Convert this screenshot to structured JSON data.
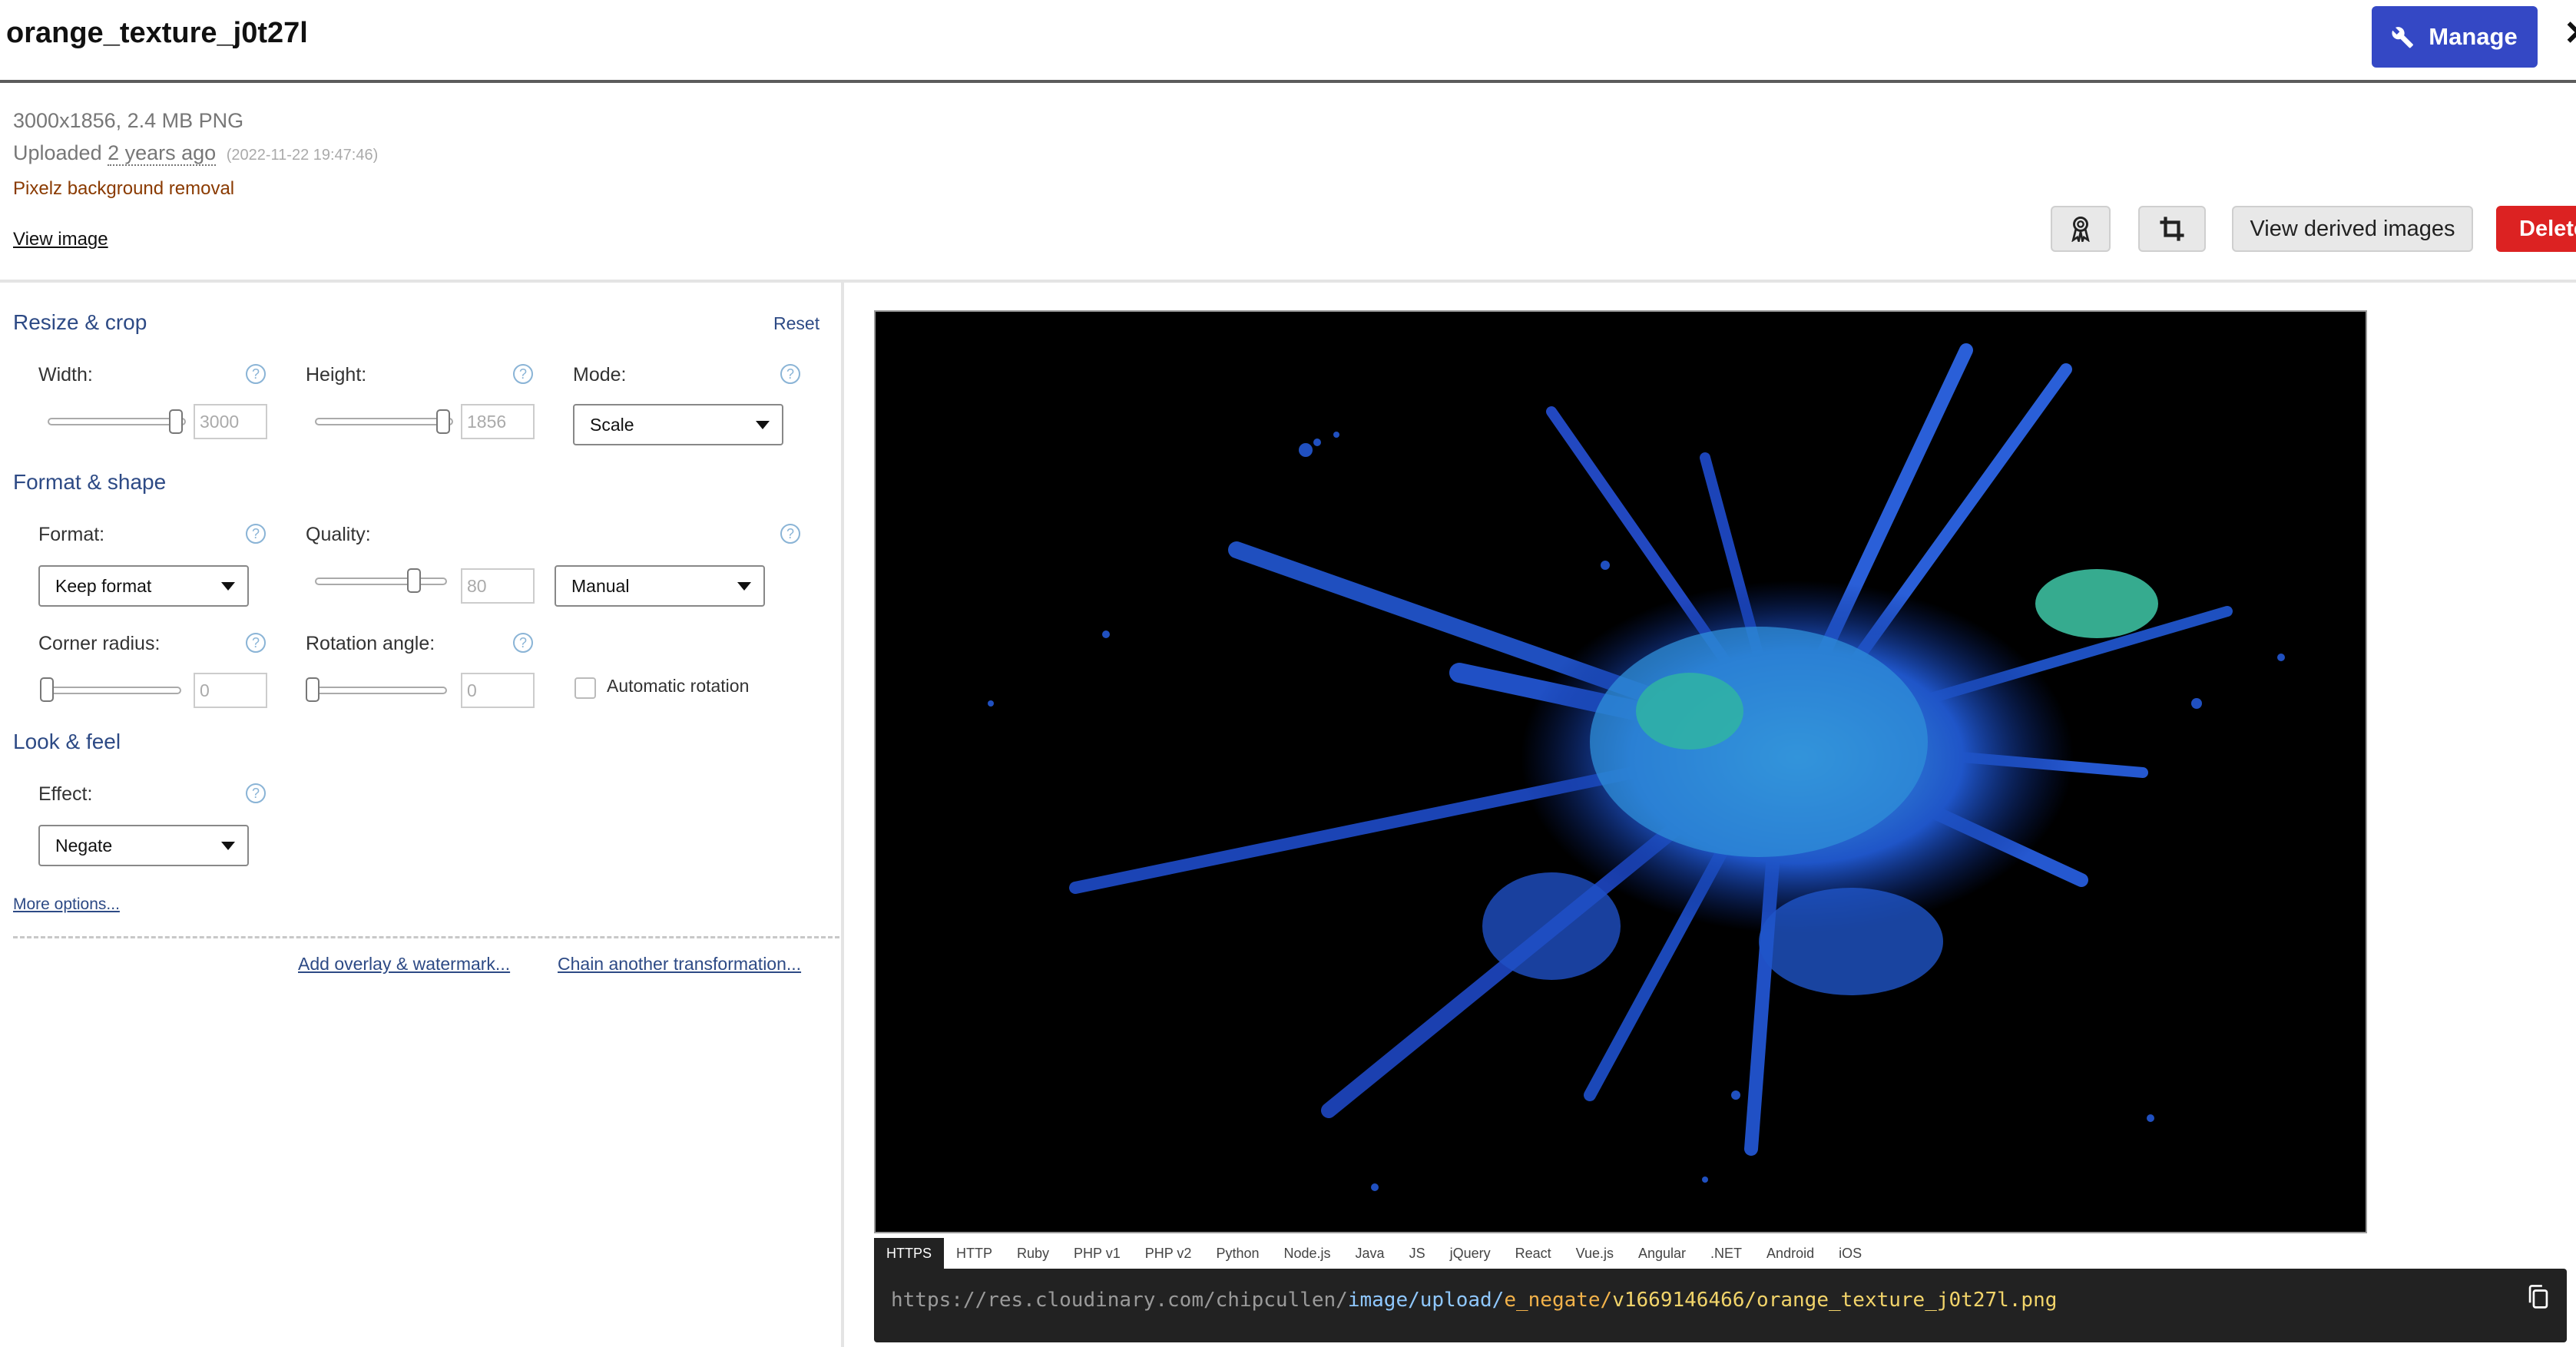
{
  "header": {
    "title": "orange_texture_j0t27l",
    "manage_label": "Manage",
    "close_glyph": "✕"
  },
  "info": {
    "dimensions": "3000x1856, 2.4 MB PNG",
    "uploaded_prefix": "Uploaded",
    "uploaded_relative": "2 years ago",
    "uploaded_timestamp": "(2022-11-22 19:47:46)",
    "addon": "Pixelz background removal",
    "view_image": "View image"
  },
  "toolbar": {
    "badge_icon": "award-ribbon-icon",
    "crop_icon": "crop-icon",
    "view_derived_label": "View derived images",
    "delete_label": "Delete"
  },
  "panel": {
    "resize": {
      "title": "Resize & crop",
      "reset": "Reset",
      "width_label": "Width:",
      "width_value": "3000",
      "height_label": "Height:",
      "height_value": "1856",
      "mode_label": "Mode:",
      "mode_value": "Scale"
    },
    "format": {
      "title": "Format & shape",
      "format_label": "Format:",
      "format_value": "Keep format",
      "quality_label": "Quality:",
      "quality_value": "80",
      "quality_mode": "Manual",
      "corner_label": "Corner radius:",
      "corner_value": "0",
      "rotation_label": "Rotation angle:",
      "rotation_value": "0",
      "auto_rotation": "Automatic rotation"
    },
    "look": {
      "title": "Look & feel",
      "effect_label": "Effect:",
      "effect_value": "Negate"
    },
    "more_options": "More options...",
    "add_overlay": "Add overlay & watermark...",
    "chain": "Chain another transformation..."
  },
  "code": {
    "tabs": [
      "HTTPS",
      "HTTP",
      "Ruby",
      "PHP v1",
      "PHP v2",
      "Python",
      "Node.js",
      "Java",
      "JS",
      "jQuery",
      "React",
      "Vue.js",
      "Angular",
      ".NET",
      "Android",
      "iOS"
    ],
    "active_tab": "HTTPS",
    "url_base": "https://res.cloudinary.com/chipcullen/",
    "url_path": "image/upload/",
    "url_transform": "e_negate/",
    "url_rest": "v1669146466/orange_texture_j0t27l.png"
  },
  "colors": {
    "manage_bg": "#3448c5",
    "delete_bg": "#dc2222",
    "section_title": "#2d4a85",
    "url_path": "#8fc8ff",
    "url_transform": "#f2b24a",
    "url_rest": "#f2d46a"
  }
}
